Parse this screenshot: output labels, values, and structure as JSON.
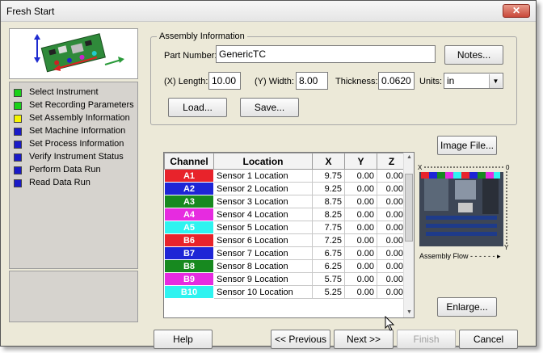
{
  "window": {
    "title": "Fresh Start",
    "close_label": "✕"
  },
  "steps": [
    {
      "label": "Select Instrument",
      "color": "#19d119"
    },
    {
      "label": "Set Recording Parameters",
      "color": "#19d119"
    },
    {
      "label": "Set Assembly Information",
      "color": "#f5f500"
    },
    {
      "label": "Set Machine Information",
      "color": "#1a1ac8"
    },
    {
      "label": "Set Process Information",
      "color": "#1a1ac8"
    },
    {
      "label": "Verify Instrument Status",
      "color": "#1a1ac8"
    },
    {
      "label": "Perform Data Run",
      "color": "#1a1ac8"
    },
    {
      "label": "Read Data Run",
      "color": "#1a1ac8"
    }
  ],
  "assembly": {
    "group_title": "Assembly Information",
    "part_number_label": "Part Number:",
    "part_number_value": "GenericTC",
    "notes_button": "Notes...",
    "length_label": "(X) Length:",
    "length_value": "10.00",
    "width_label": "(Y) Width:",
    "width_value": "8.00",
    "thickness_label": "Thickness:",
    "thickness_value": "0.0620",
    "units_label": "Units:",
    "units_value": "in",
    "load_button": "Load...",
    "save_button": "Save..."
  },
  "image_file_button": "Image File...",
  "enlarge_button": "Enlarge...",
  "assembly_flow_label": "Assembly Flow",
  "axis_labels": {
    "x": "X",
    "y": "Y",
    "origin": "0"
  },
  "table": {
    "headers": [
      "Channel",
      "Location",
      "X",
      "Y",
      "Z"
    ],
    "rows": [
      {
        "channel": "A1",
        "color": "#e8232b",
        "location": "Sensor 1 Location",
        "x": "9.75",
        "y": "0.00",
        "z": "0.00"
      },
      {
        "channel": "A2",
        "color": "#1e25d6",
        "location": "Sensor 2 Location",
        "x": "9.25",
        "y": "0.00",
        "z": "0.00"
      },
      {
        "channel": "A3",
        "color": "#17891f",
        "location": "Sensor 3 Location",
        "x": "8.75",
        "y": "0.00",
        "z": "0.00"
      },
      {
        "channel": "A4",
        "color": "#e62be0",
        "location": "Sensor 4 Location",
        "x": "8.25",
        "y": "0.00",
        "z": "0.00"
      },
      {
        "channel": "A5",
        "color": "#2ef3f0",
        "location": "Sensor 5 Location",
        "x": "7.75",
        "y": "0.00",
        "z": "0.00"
      },
      {
        "channel": "B6",
        "color": "#e8232b",
        "location": "Sensor 6 Location",
        "x": "7.25",
        "y": "0.00",
        "z": "0.00"
      },
      {
        "channel": "B7",
        "color": "#1e25d6",
        "location": "Sensor 7 Location",
        "x": "6.75",
        "y": "0.00",
        "z": "0.00"
      },
      {
        "channel": "B8",
        "color": "#17891f",
        "location": "Sensor 8 Location",
        "x": "6.25",
        "y": "0.00",
        "z": "0.00"
      },
      {
        "channel": "B9",
        "color": "#e62be0",
        "location": "Sensor 9 Location",
        "x": "5.75",
        "y": "0.00",
        "z": "0.00"
      },
      {
        "channel": "B10",
        "color": "#2ef3f0",
        "location": "Sensor 10 Location",
        "x": "5.25",
        "y": "0.00",
        "z": "0.00"
      }
    ]
  },
  "nav": {
    "help": "Help",
    "previous": "<< Previous",
    "next": "Next >>",
    "finish": "Finish",
    "cancel": "Cancel"
  }
}
